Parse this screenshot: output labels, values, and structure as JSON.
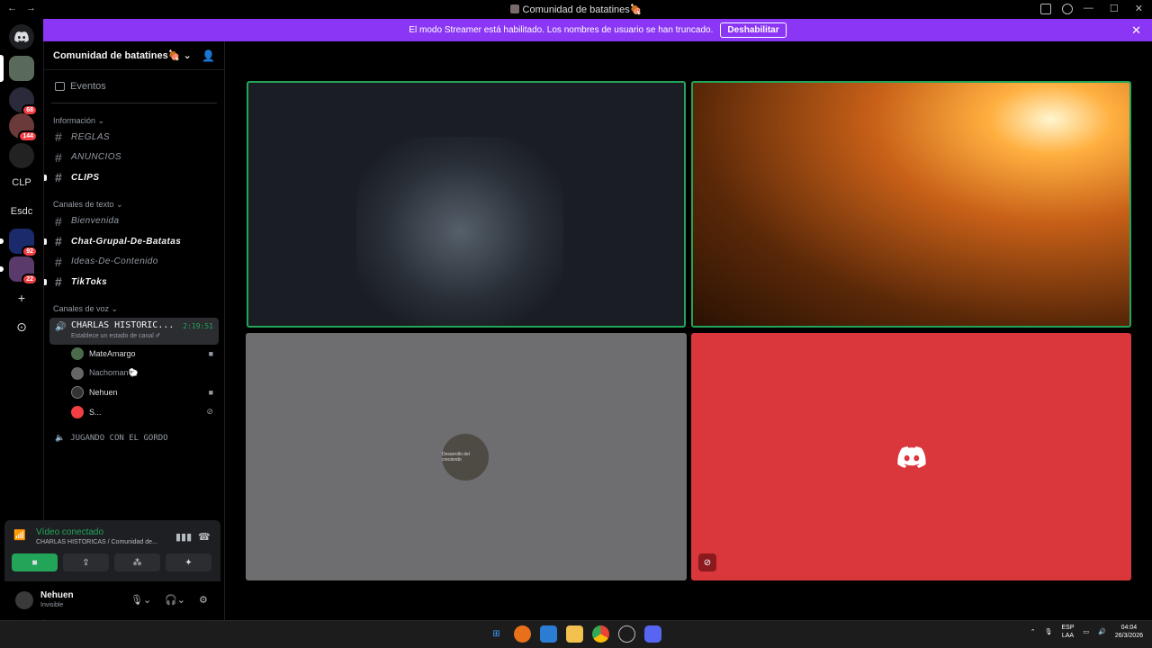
{
  "window": {
    "title": "Comunidad de batatines🍖",
    "back_icon": "←",
    "fwd_icon": "→",
    "minimize": "—",
    "maximize": "☐",
    "close": "✕"
  },
  "banner": {
    "text": "El modo Streamer está habilitado. Los nombres de usuario se han truncado.",
    "button": "Deshabilitar",
    "close": "✕"
  },
  "guilds": [
    {
      "label": "",
      "badge": ""
    },
    {
      "label": "",
      "badge": "68"
    },
    {
      "label": "",
      "badge": "144"
    },
    {
      "label": "",
      "badge": ""
    },
    {
      "label": "CLP",
      "badge": ""
    },
    {
      "label": "Esdc",
      "badge": ""
    },
    {
      "label": "",
      "badge": "92"
    },
    {
      "label": "",
      "badge": "22"
    },
    {
      "label": "+",
      "badge": ""
    },
    {
      "label": "⊙",
      "badge": ""
    }
  ],
  "server": {
    "name": "Comunidad de batatines🍖",
    "chevron": "⌄"
  },
  "sidebar": {
    "events": "Eventos",
    "categories": [
      {
        "name": "Información ⌄",
        "channels": [
          {
            "name": "REGLAS",
            "unread": false
          },
          {
            "name": "ANUNCIOS",
            "unread": false
          },
          {
            "name": "CLIPS",
            "unread": true
          }
        ]
      },
      {
        "name": "Canales de texto ⌄",
        "channels": [
          {
            "name": "Bienvenida",
            "unread": false
          },
          {
            "name": "Chat-Grupal-De-Batatas",
            "unread": true
          },
          {
            "name": "Ideas-De-Contenido",
            "unread": false
          },
          {
            "name": "TikToks",
            "unread": true
          }
        ]
      }
    ],
    "voice_category": "Canales de voz ⌄",
    "voice_active": {
      "name": "CHARLAS HISTORIC...",
      "time": "2:19:51",
      "status": "Establece un estado de canal ✐"
    },
    "members": [
      {
        "name": "MateAmargo",
        "camera": true,
        "muted": false,
        "dim": false
      },
      {
        "name": "Nachoman🐑",
        "camera": false,
        "muted": false,
        "dim": true
      },
      {
        "name": "Nehuen",
        "camera": true,
        "muted": false,
        "dim": false
      },
      {
        "name": "S...",
        "camera": false,
        "muted": true,
        "dim": false
      }
    ],
    "voice_other": "JUGANDO CON EL GORDO"
  },
  "voice_panel": {
    "status": "Vídeo conectado",
    "channel": "CHARLAS HISTORICAS / Comunidad de...",
    "user_name": "Nehuen",
    "user_status": "Invisible"
  },
  "tiles": {
    "avatar_caption": "Desarrollo del creciendo"
  },
  "taskbar": {
    "lang_top": "ESP",
    "lang_bottom": "LAA",
    "time": "04:04",
    "date": "26/3/2026"
  },
  "colors": {
    "accent": "#8b36f5",
    "connected": "#23a559",
    "danger": "#da373c"
  }
}
